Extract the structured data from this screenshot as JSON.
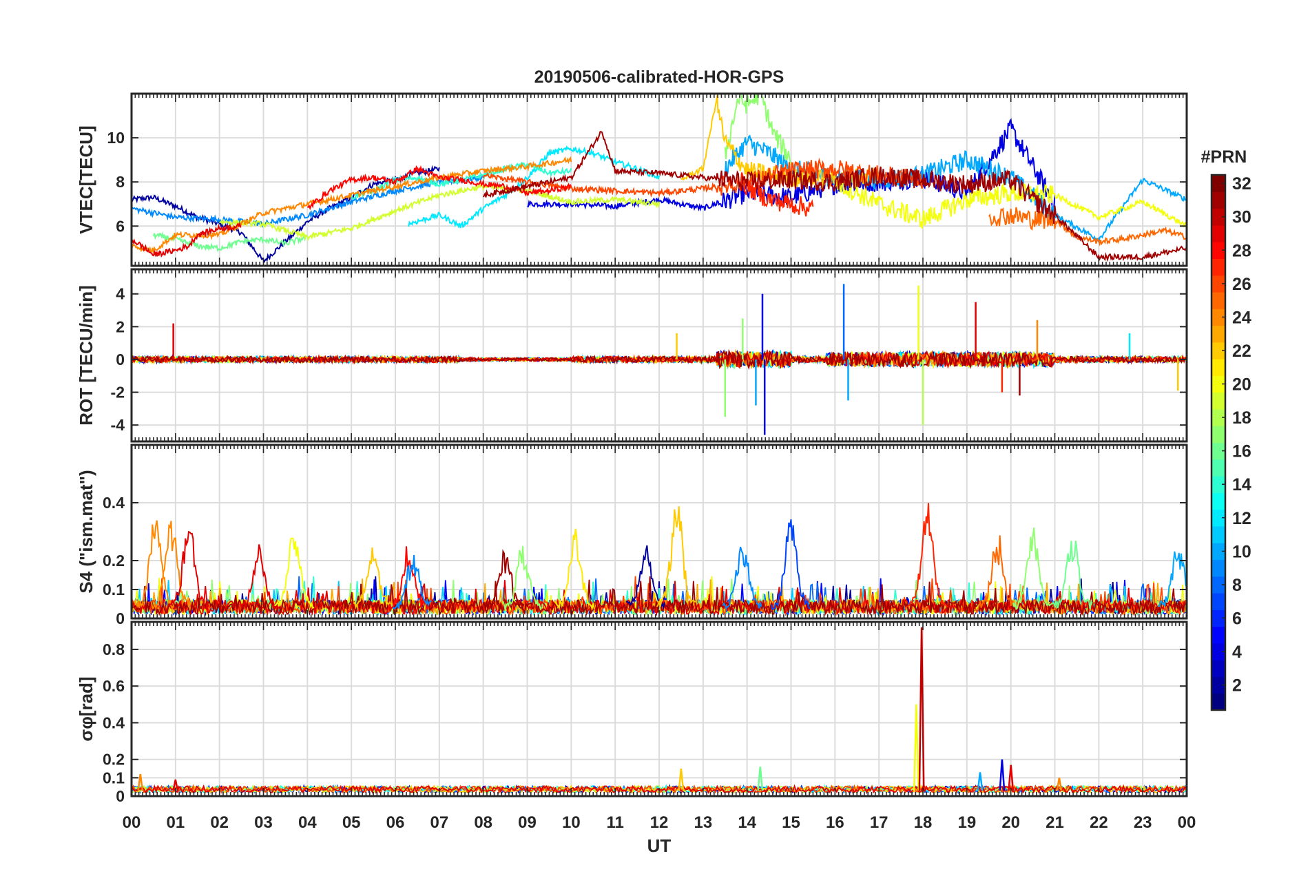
{
  "figure": {
    "title": "20190506-calibrated-HOR-GPS",
    "xlabel": "UT",
    "x_tick_labels": [
      "00",
      "01",
      "02",
      "03",
      "04",
      "05",
      "06",
      "07",
      "08",
      "09",
      "10",
      "11",
      "12",
      "13",
      "14",
      "15",
      "16",
      "17",
      "18",
      "19",
      "20",
      "21",
      "22",
      "23",
      "00"
    ]
  },
  "colorbar": {
    "title": "#PRN",
    "range": [
      1,
      32
    ],
    "tick_labels": [
      "2",
      "4",
      "6",
      "8",
      "10",
      "12",
      "14",
      "16",
      "18",
      "20",
      "22",
      "24",
      "26",
      "28",
      "30",
      "32"
    ],
    "tick_values": [
      2,
      4,
      6,
      8,
      10,
      12,
      14,
      16,
      18,
      20,
      22,
      24,
      26,
      28,
      30,
      32
    ],
    "colormap": "jet",
    "levels": 32
  },
  "chart_data": [
    {
      "type": "line",
      "name": "vtec",
      "ylabel": "VTEC[TECU]",
      "ylim": [
        4.2,
        12
      ],
      "yticks": [
        6,
        8,
        10
      ],
      "ytick_labels": [
        "6",
        "8",
        "10"
      ],
      "xlim": [
        0,
        24
      ],
      "grid": true,
      "series_note_prn_colored": true,
      "series": [
        {
          "prn": 2,
          "x": [
            0,
            0.5,
            1,
            1.5,
            2,
            2.5,
            3,
            3.5,
            4,
            4.5,
            5,
            5.5,
            6,
            6.5,
            7
          ],
          "y": [
            7.2,
            7.3,
            6.9,
            6.4,
            6.1,
            5.7,
            4.4,
            5.3,
            6.2,
            6.8,
            7.3,
            7.9,
            8.1,
            8.4,
            8.6
          ]
        },
        {
          "prn": 4,
          "x": [
            9,
            10,
            11,
            12,
            13,
            14,
            15,
            16,
            17,
            18,
            19,
            20,
            21
          ],
          "y": [
            7.0,
            7.0,
            6.9,
            7.2,
            6.8,
            7.5,
            7.3,
            7.9,
            8.0,
            8.2,
            7.5,
            10.4,
            7.0
          ]
        },
        {
          "prn": 9,
          "x": [
            0,
            1,
            2,
            3,
            4,
            5,
            6,
            7,
            8
          ],
          "y": [
            6.8,
            6.4,
            6.3,
            6.1,
            6.5,
            7.1,
            7.6,
            8.0,
            8.2
          ]
        },
        {
          "prn": 10,
          "x": [
            13.5,
            14,
            14.5,
            15,
            15.5,
            16,
            17,
            18,
            19,
            20,
            21,
            22,
            23,
            24
          ],
          "y": [
            8.6,
            9.8,
            9.3,
            8.6,
            8.4,
            8.2,
            8.1,
            8.3,
            9.0,
            8.2,
            6.5,
            5.4,
            8.1,
            7.2
          ]
        },
        {
          "prn": 12,
          "x": [
            6.3,
            7,
            7.5,
            8,
            8.5,
            9,
            9.5,
            10,
            10.5,
            11,
            11.5,
            12
          ],
          "y": [
            6.1,
            6.5,
            6.0,
            6.8,
            7.4,
            8.2,
            9.3,
            9.5,
            9.3,
            8.9,
            8.6,
            8.2
          ]
        },
        {
          "prn": 14,
          "x": [
            5,
            5.5,
            6,
            6.5,
            7,
            7.5,
            8,
            8.5,
            9,
            9.5,
            10
          ],
          "y": [
            7.3,
            7.6,
            8.1,
            8.2,
            7.9,
            8.1,
            8.3,
            8.6,
            8.8,
            8.4,
            8.5
          ]
        },
        {
          "prn": 16,
          "x": [
            0.5,
            1,
            1.5,
            2,
            2.5,
            3,
            3.5,
            4
          ],
          "y": [
            5.6,
            5.4,
            5.1,
            5.0,
            5.3,
            5.4,
            5.2,
            5.5
          ]
        },
        {
          "prn": 17,
          "x": [
            13.5,
            13.8,
            14,
            14.3,
            14.6,
            15
          ],
          "y": [
            9.2,
            11.8,
            11.5,
            12.0,
            10.2,
            9.0
          ]
        },
        {
          "prn": 19,
          "x": [
            2,
            3,
            4,
            5,
            6,
            7,
            8,
            9,
            10,
            11,
            12
          ],
          "y": [
            6.2,
            6.1,
            5.5,
            5.9,
            6.7,
            7.4,
            7.8,
            7.6,
            7.1,
            7.2,
            7.0
          ]
        },
        {
          "prn": 20,
          "x": [
            16,
            17,
            18,
            19,
            20,
            21,
            22,
            23,
            24
          ],
          "y": [
            8.0,
            7.0,
            6.3,
            7.2,
            7.5,
            7.4,
            6.4,
            7.1,
            6.0
          ]
        },
        {
          "prn": 22,
          "x": [
            12.5,
            13,
            13.3,
            13.5,
            14,
            15,
            16,
            17
          ],
          "y": [
            8.1,
            8.6,
            11.7,
            9.8,
            8.5,
            8.2,
            8.1,
            8.3
          ]
        },
        {
          "prn": 24,
          "x": [
            0,
            0.5,
            1,
            2,
            3,
            4,
            5,
            6,
            7,
            8,
            9,
            10
          ],
          "y": [
            5.1,
            4.9,
            5.6,
            5.6,
            6.6,
            7.0,
            7.4,
            7.8,
            8.2,
            8.5,
            8.7,
            9.0
          ]
        },
        {
          "prn": 25,
          "x": [
            19.5,
            20,
            20.5,
            21,
            21.5,
            22,
            22.5,
            23,
            23.5,
            24
          ],
          "y": [
            6.4,
            6.5,
            6.3,
            6.3,
            5.5,
            5.3,
            5.4,
            5.6,
            5.8,
            5.5
          ]
        },
        {
          "prn": 26,
          "x": [
            8,
            9,
            10,
            11,
            12,
            13,
            14,
            15,
            16,
            17,
            18
          ],
          "y": [
            8.3,
            8.0,
            7.7,
            7.6,
            7.5,
            7.7,
            8.0,
            8.5,
            8.6,
            8.3,
            8.1
          ]
        },
        {
          "prn": 27,
          "x": [
            13.8,
            14,
            14.5,
            15,
            15.5
          ],
          "y": [
            8.1,
            7.8,
            7.2,
            7.0,
            6.8
          ]
        },
        {
          "prn": 28,
          "x": [
            4,
            4.5,
            5,
            5.5,
            6,
            6.5,
            7,
            7.5,
            8,
            8.5,
            9,
            9.5,
            10
          ],
          "y": [
            6.8,
            7.6,
            8.1,
            8.2,
            8.0,
            8.6,
            8.2,
            8.1,
            7.9,
            7.8,
            7.5,
            7.6,
            7.8
          ]
        },
        {
          "prn": 29,
          "x": [
            0,
            0.3,
            0.5,
            1,
            1.3,
            1.5,
            2,
            2.5
          ],
          "y": [
            5.4,
            5.0,
            4.7,
            4.9,
            5.1,
            5.6,
            5.9,
            6.0
          ]
        },
        {
          "prn": 31,
          "x": [
            8,
            9,
            10,
            10.7,
            11,
            12,
            13,
            14,
            15,
            16,
            17,
            18,
            19,
            20,
            20.5,
            21,
            22,
            23,
            24
          ],
          "y": [
            7.4,
            7.8,
            8.2,
            10.3,
            8.5,
            8.4,
            8.2,
            8.0,
            8.1,
            8.0,
            8.3,
            8.1,
            7.9,
            8.1,
            7.2,
            6.5,
            4.6,
            4.6,
            5.0
          ]
        }
      ]
    },
    {
      "type": "line",
      "name": "rot",
      "ylabel": "ROT [TECU/min]",
      "ylim": [
        -5,
        5.5
      ],
      "yticks": [
        -4,
        -2,
        0,
        2,
        4
      ],
      "ytick_labels": [
        "-4",
        "-2",
        "0",
        "2",
        "4"
      ],
      "xlim": [
        0,
        24
      ],
      "grid": true,
      "spikes": [
        {
          "prn": 29,
          "x": 0.95,
          "y": 2.2
        },
        {
          "prn": 22,
          "x": 12.4,
          "y": 1.6
        },
        {
          "prn": 17,
          "x": 13.5,
          "y": -3.5
        },
        {
          "prn": 17,
          "x": 13.9,
          "y": 2.5
        },
        {
          "prn": 4,
          "x": 14.35,
          "y": 4.0
        },
        {
          "prn": 4,
          "x": 14.4,
          "y": -4.6
        },
        {
          "prn": 10,
          "x": 14.2,
          "y": -2.8
        },
        {
          "prn": 8,
          "x": 16.2,
          "y": 4.6
        },
        {
          "prn": 10,
          "x": 16.3,
          "y": -2.5
        },
        {
          "prn": 20,
          "x": 17.9,
          "y": 4.5
        },
        {
          "prn": 18,
          "x": 18.0,
          "y": -4.0
        },
        {
          "prn": 29,
          "x": 19.2,
          "y": 3.5
        },
        {
          "prn": 27,
          "x": 19.8,
          "y": -2.0
        },
        {
          "prn": 31,
          "x": 20.2,
          "y": -2.2
        },
        {
          "prn": 24,
          "x": 20.6,
          "y": 2.4
        },
        {
          "prn": 12,
          "x": 22.7,
          "y": 1.6
        },
        {
          "prn": 22,
          "x": 23.8,
          "y": -1.9
        }
      ]
    },
    {
      "type": "line",
      "name": "s4",
      "ylabel": "S4 (\"ism.mat\")",
      "ylim": [
        0,
        0.6
      ],
      "yticks": [
        0,
        0.1,
        0.2,
        0.4
      ],
      "ytick_labels": [
        "0",
        "0.1",
        "0.2",
        "0.4"
      ],
      "xlim": [
        0,
        24
      ],
      "grid": true,
      "peaks": [
        {
          "prn": 24,
          "x": 0.55,
          "y": 0.35
        },
        {
          "prn": 24,
          "x": 0.9,
          "y": 0.33
        },
        {
          "prn": 29,
          "x": 1.3,
          "y": 0.31
        },
        {
          "prn": 29,
          "x": 2.9,
          "y": 0.23
        },
        {
          "prn": 20,
          "x": 3.7,
          "y": 0.3
        },
        {
          "prn": 22,
          "x": 5.5,
          "y": 0.21
        },
        {
          "prn": 28,
          "x": 6.3,
          "y": 0.22
        },
        {
          "prn": 9,
          "x": 6.4,
          "y": 0.19
        },
        {
          "prn": 31,
          "x": 8.5,
          "y": 0.19
        },
        {
          "prn": 17,
          "x": 8.9,
          "y": 0.22
        },
        {
          "prn": 21,
          "x": 10.1,
          "y": 0.28
        },
        {
          "prn": 2,
          "x": 11.7,
          "y": 0.24
        },
        {
          "prn": 22,
          "x": 12.4,
          "y": 0.4
        },
        {
          "prn": 9,
          "x": 13.9,
          "y": 0.24
        },
        {
          "prn": 7,
          "x": 15.0,
          "y": 0.33
        },
        {
          "prn": 27,
          "x": 18.1,
          "y": 0.38
        },
        {
          "prn": 25,
          "x": 19.7,
          "y": 0.25
        },
        {
          "prn": 17,
          "x": 20.5,
          "y": 0.28
        },
        {
          "prn": 16,
          "x": 21.4,
          "y": 0.27
        },
        {
          "prn": 10,
          "x": 23.8,
          "y": 0.24
        }
      ]
    },
    {
      "type": "line",
      "name": "sigma_phi",
      "ylabel": "σφ[rad]",
      "ylim": [
        0,
        0.95
      ],
      "yticks": [
        0,
        0.1,
        0.2,
        0.4,
        0.6,
        0.8
      ],
      "ytick_labels": [
        "0",
        "0.1",
        "0.2",
        "0.4",
        "0.6",
        "0.8"
      ],
      "xlim": [
        0,
        24
      ],
      "grid": true,
      "peaks": [
        {
          "prn": 24,
          "x": 0.2,
          "y": 0.12
        },
        {
          "prn": 29,
          "x": 1.0,
          "y": 0.09
        },
        {
          "prn": 22,
          "x": 12.5,
          "y": 0.15
        },
        {
          "prn": 16,
          "x": 14.3,
          "y": 0.16
        },
        {
          "prn": 20,
          "x": 17.85,
          "y": 0.5
        },
        {
          "prn": 30,
          "x": 17.97,
          "y": 0.92
        },
        {
          "prn": 10,
          "x": 19.3,
          "y": 0.13
        },
        {
          "prn": 4,
          "x": 19.8,
          "y": 0.2
        },
        {
          "prn": 29,
          "x": 20.0,
          "y": 0.17
        },
        {
          "prn": 24,
          "x": 21.1,
          "y": 0.1
        }
      ]
    }
  ]
}
